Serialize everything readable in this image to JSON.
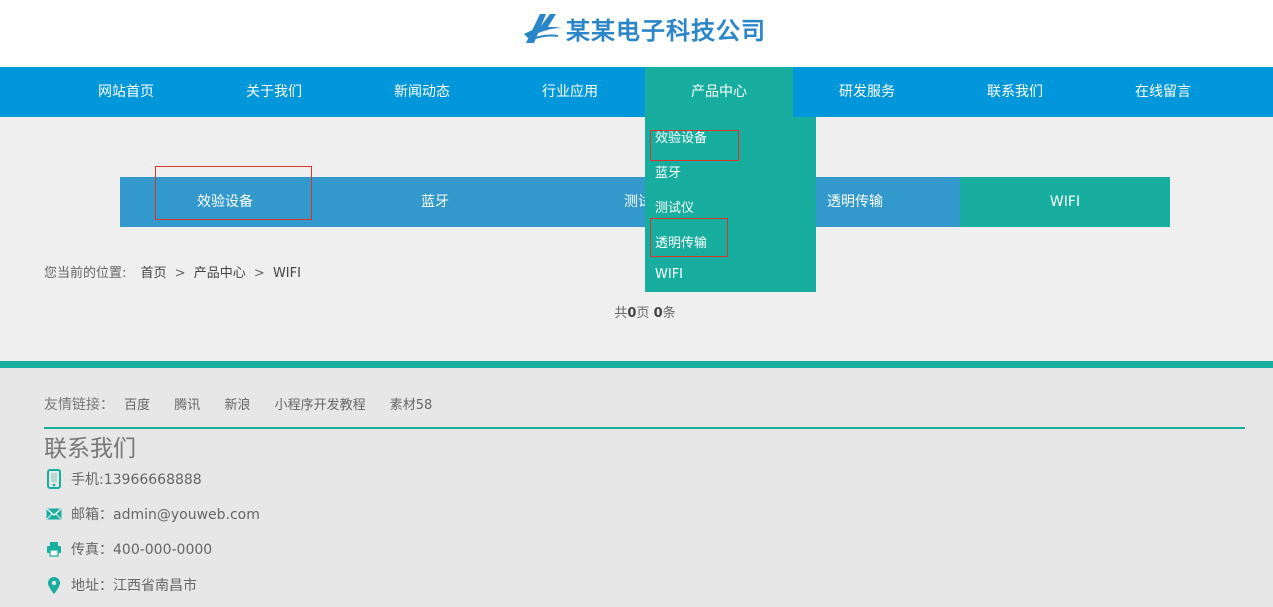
{
  "header": {
    "logo_text": "某某电子科技公司"
  },
  "nav": {
    "items": [
      "网站首页",
      "关于我们",
      "新闻动态",
      "行业应用",
      "产品中心",
      "研发服务",
      "联系我们",
      "在线留言"
    ]
  },
  "dropdown": {
    "items": [
      "效验设备",
      "蓝牙",
      "测试仪",
      "透明传输",
      "WIFI"
    ]
  },
  "subnav": {
    "items": [
      "效验设备",
      "蓝牙",
      "测试仪",
      "透明传输",
      "WIFI"
    ],
    "hidden_prefix": "测试"
  },
  "breadcrumb": {
    "label": "您当前的位置:",
    "home": "首页",
    "sep": ">",
    "category": "产品中心",
    "current": "WIFI"
  },
  "pager": {
    "prefix": "共",
    "pages": "0",
    "pages_unit": "页",
    "items": "0",
    "items_unit": "条"
  },
  "footer": {
    "links_label": "友情链接：",
    "links": [
      "百度",
      "腾讯",
      "新浪",
      "小程序开发教程",
      "素材58"
    ],
    "contact_title": "联系我们",
    "phone": "手机:13966668888",
    "email": "邮箱：admin@youweb.com",
    "fax": "传真：400-000-0000",
    "address": "地址：江西省南昌市"
  },
  "colors": {
    "nav_bg": "#0197da",
    "accent": "#17ae9f",
    "subnav_bg": "#3399cc",
    "highlight_border": "#d9352b"
  }
}
